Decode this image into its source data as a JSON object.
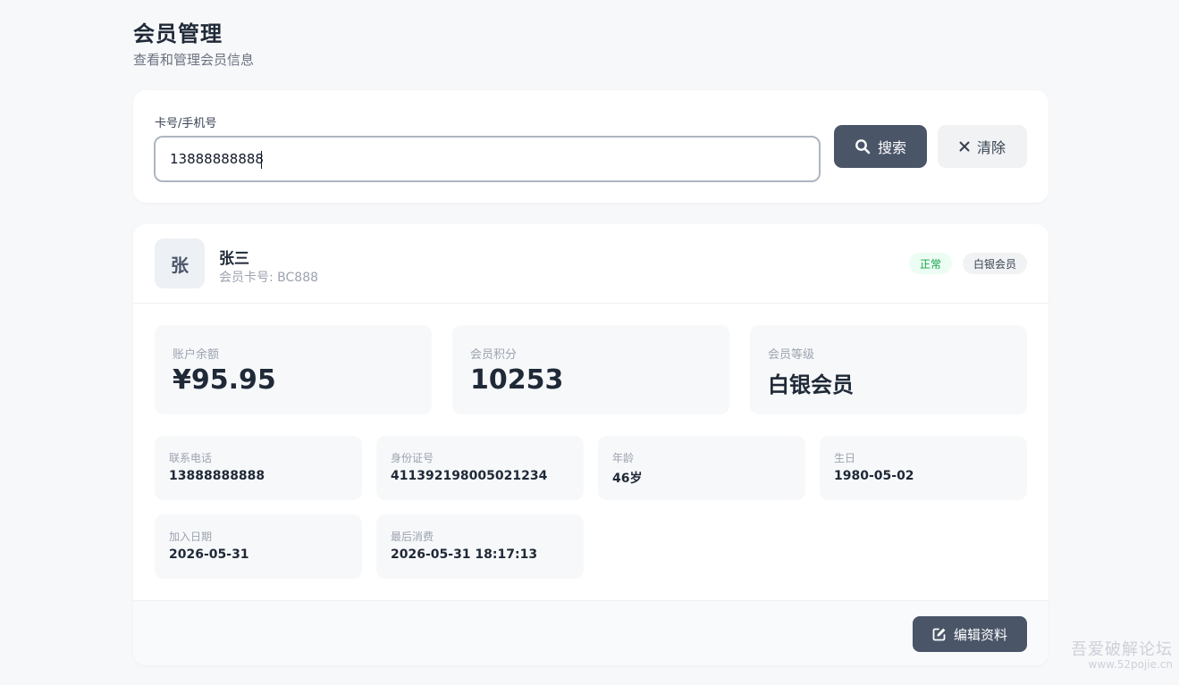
{
  "page": {
    "title": "会员管理",
    "subtitle": "查看和管理会员信息"
  },
  "search": {
    "label": "卡号/手机号",
    "value": "13888888888",
    "placeholder": "",
    "search_label": "搜索",
    "search_icon": "search-icon",
    "clear_label": "清除",
    "clear_icon": "close-icon"
  },
  "member": {
    "avatar_char": "张",
    "name": "张三",
    "card_line": "会员卡号: BC888",
    "status_badge": "正常",
    "level_badge": "白银会员",
    "stats": {
      "balance_label": "账户余额",
      "balance_value": "¥95.95",
      "points_label": "会员积分",
      "points_value": "10253",
      "level_label": "会员等级",
      "level_value": "白银会员"
    },
    "info": {
      "phone_label": "联系电话",
      "phone_value": "13888888888",
      "id_label": "身份证号",
      "id_value": "411392198005021234",
      "age_label": "年龄",
      "age_value": "46岁",
      "birthday_label": "生日",
      "birthday_value": "1980-05-02",
      "join_label": "加入日期",
      "join_value": "2026-05-31",
      "last_label": "最后消费",
      "last_value": "2026-05-31 18:17:13"
    },
    "edit_label": "编辑资料",
    "edit_icon": "edit-icon"
  },
  "watermark": {
    "line1": "吾爱破解论坛",
    "line2": "www.52pojie.cn"
  },
  "colors": {
    "accent": "#4a5568",
    "background": "#f7f8fa",
    "status_green": "#16a34a"
  }
}
